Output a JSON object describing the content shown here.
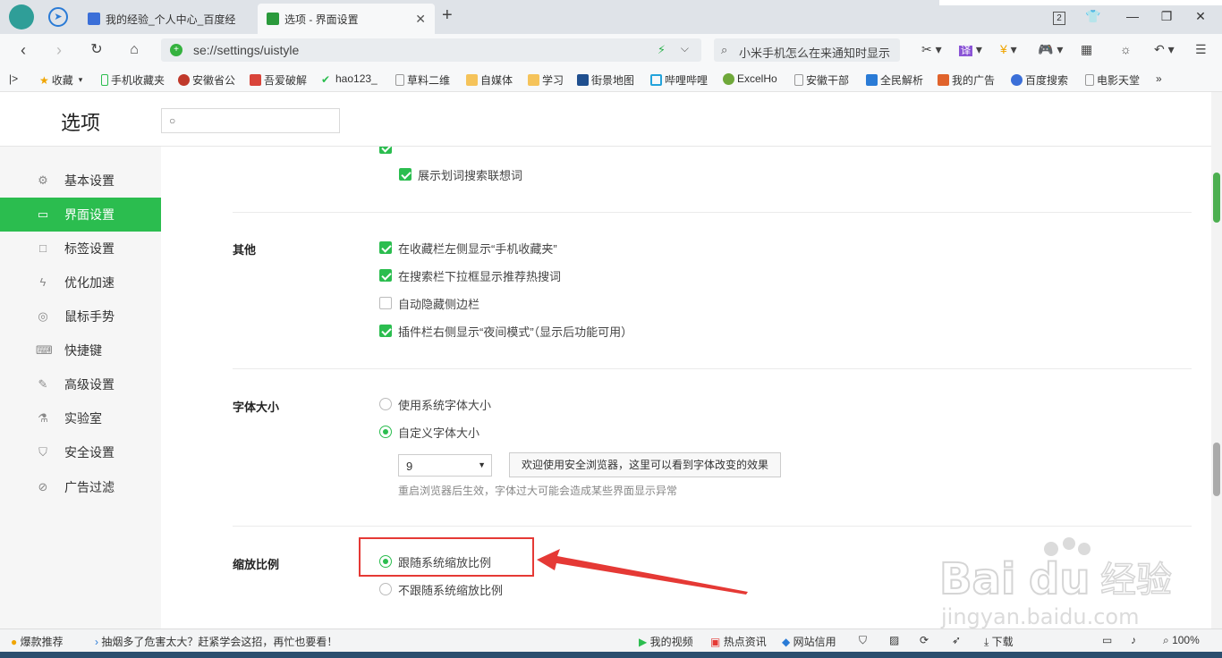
{
  "tabs": [
    {
      "label": "我的经验_个人中心_百度经",
      "active": false
    },
    {
      "label": "选项 - 界面设置",
      "active": true
    }
  ],
  "tab_badge": "2",
  "address": {
    "url": "se://settings/uistyle"
  },
  "search": {
    "text": "小米手机怎么在来通知时显示"
  },
  "bookmarks": [
    "收藏",
    "手机收藏夹",
    "安徽省公",
    "吾爱破解",
    "hao123_",
    "草料二维",
    "自媒体",
    "学习",
    "街景地图",
    "哔哩哔哩",
    "ExcelHo",
    "安徽干部",
    "全民解析",
    "我的广告",
    "百度搜索",
    "电影天堂"
  ],
  "page": {
    "title": "选项",
    "search_placeholder": ""
  },
  "sidebar": {
    "items": [
      {
        "label": "基本设置",
        "icon": "gear-icon"
      },
      {
        "label": "界面设置",
        "icon": "window-icon",
        "active": true
      },
      {
        "label": "标签设置",
        "icon": "tab-icon"
      },
      {
        "label": "优化加速",
        "icon": "bolt-icon"
      },
      {
        "label": "鼠标手势",
        "icon": "mouse-icon"
      },
      {
        "label": "快捷键",
        "icon": "keyboard-icon"
      },
      {
        "label": "高级设置",
        "icon": "wrench-icon"
      },
      {
        "label": "实验室",
        "icon": "flask-icon"
      },
      {
        "label": "安全设置",
        "icon": "shield-icon"
      },
      {
        "label": "广告过滤",
        "icon": "block-icon"
      }
    ]
  },
  "sections": {
    "top_option": {
      "label": "展示划词搜索联想词",
      "checked": true
    },
    "other": {
      "label": "其他",
      "options": [
        {
          "label": "在收藏栏左侧显示“手机收藏夹”",
          "checked": true
        },
        {
          "label": "在搜索栏下拉框显示推荐热搜词",
          "checked": true
        },
        {
          "label": "自动隐藏侧边栏",
          "checked": false
        },
        {
          "label": "插件栏右侧显示“夜间模式”（显示后功能可用）",
          "checked": true
        }
      ]
    },
    "font_size": {
      "label": "字体大小",
      "options": [
        {
          "label": "使用系统字体大小",
          "selected": false
        },
        {
          "label": "自定义字体大小",
          "selected": true
        }
      ],
      "value": "9",
      "preview_button": "欢迎使用安全浏览器，这里可以看到字体改变的效果",
      "hint": "重启浏览器后生效，字体过大可能会造成某些界面显示异常"
    },
    "zoom": {
      "label": "缩放比例",
      "options": [
        {
          "label": "跟随系统缩放比例",
          "selected": true
        },
        {
          "label": "不跟随系统缩放比例",
          "selected": false
        }
      ]
    }
  },
  "statusbar": {
    "promo": "爆款推荐",
    "news": "抽烟多了危害太大？赶紧学会这招，再忙也要看！",
    "video": "我的视频",
    "hot": "热点资讯",
    "credit": "网站信用",
    "download": "下载",
    "zoom": "100%"
  },
  "colors": {
    "accent": "#2bbd4f",
    "annotation": "#e53935"
  }
}
